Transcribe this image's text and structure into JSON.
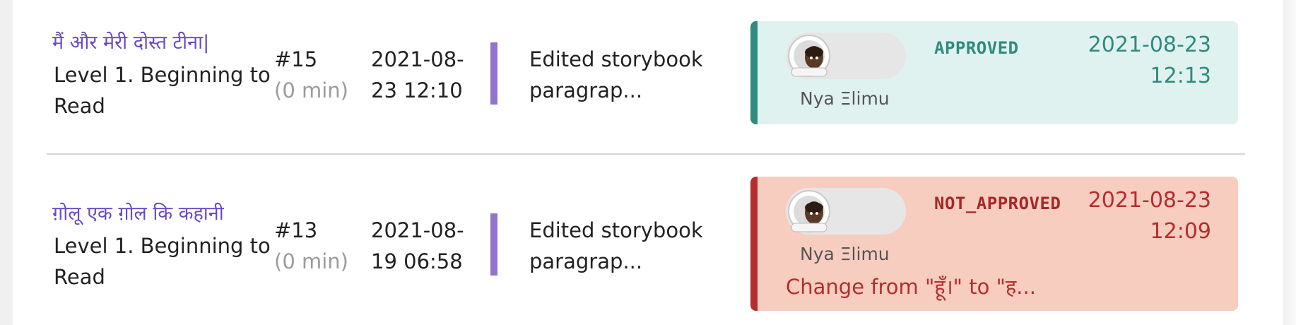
{
  "rows": [
    {
      "story_title": "मैं और मेरी दोस्त टीना|",
      "story_level": "Level 1. Beginning to Read",
      "revision_number": "#15",
      "duration": "(0 min)",
      "revision_date": "2021-08-23 12:10",
      "edit_description": "Edited storybook paragrap...",
      "review": {
        "reviewer_name": "Nya Ξlimu",
        "status": "APPROVED",
        "date": "2021-08-23 12:13",
        "comment": ""
      }
    },
    {
      "story_title": "ग़ोलू एक ग़ोल कि कहानी",
      "story_level": "Level 1. Beginning to Read",
      "revision_number": "#13",
      "duration": "(0 min)",
      "revision_date": "2021-08-19 06:58",
      "edit_description": "Edited storybook paragrap...",
      "review": {
        "reviewer_name": "Nya Ξlimu",
        "status": "NOT_APPROVED",
        "date": "2021-08-23 12:09",
        "comment": "Change from \"हूँ।\" to \"ह..."
      }
    }
  ],
  "colors": {
    "link": "#6a4ac0",
    "approved": "#2e8b7d",
    "approved_bg": "#e0f2f0",
    "not_approved": "#b52d2d",
    "not_approved_bg": "#f7cdc0",
    "revision_bar": "#9274cc"
  },
  "icons": {
    "reviewer_avatar": "astronaut-avatar-icon"
  }
}
